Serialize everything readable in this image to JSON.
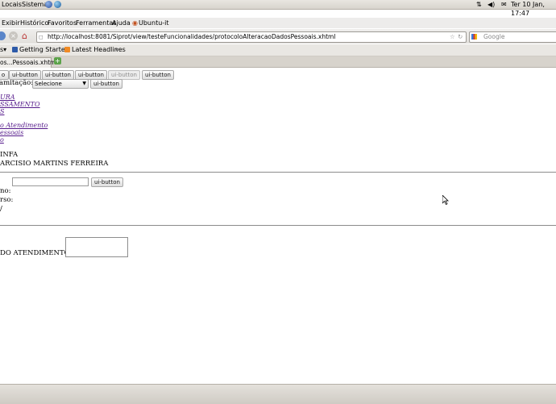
{
  "panel": {
    "menu_places": "Locais",
    "menu_system": "Sistema",
    "clock": "Ter 10 Jan, 17:47"
  },
  "menubar": {
    "items": [
      "Exibir",
      "Histórico",
      "Favoritos",
      "Ferramentas",
      "Ajuda",
      "Ubuntu-it"
    ]
  },
  "navbar": {
    "url": "http://localhost:8081/Siprot/view/testeFuncionalidades/protocoloAlteracaoDadosPessoais.xhtml",
    "search_placeholder": "Google"
  },
  "bookmarks": {
    "items": [
      "Getting Started",
      "Latest Headlines"
    ]
  },
  "tab": {
    "title": "os...Pessoais.xhtml"
  },
  "page": {
    "buttons": [
      {
        "label": "o",
        "disabled": false
      },
      {
        "label": "ui-button",
        "disabled": false
      },
      {
        "label": "ui-button",
        "disabled": false
      },
      {
        "label": "ui-button",
        "disabled": false
      },
      {
        "label": "ui-button",
        "disabled": true
      },
      {
        "label": "ui-button",
        "disabled": false
      }
    ],
    "tramitacao_label": "amitação:",
    "tramitacao_select": "Selecione",
    "tramitacao_button": "ui-button",
    "links": [
      "URA",
      "SSAMENTO",
      "S",
      "o Atendimento",
      "essoais",
      "o"
    ],
    "info_lines": [
      "INFA",
      "ARCISIO MARTINS FERREIRA"
    ],
    "search_button": "ui-button",
    "field_labels": [
      "no:",
      "rso:",
      "/"
    ],
    "atendimento_label": "DO ATENDIMENTO:"
  }
}
